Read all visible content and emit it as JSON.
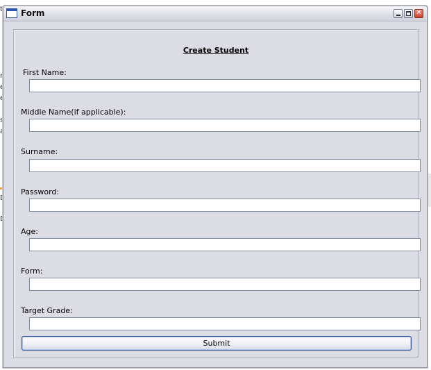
{
  "window": {
    "title": "Form",
    "minimize_icon": "minimize-icon",
    "maximize_icon": "maximize-icon",
    "close_icon": "close-icon",
    "close_color": "#d24a32"
  },
  "form": {
    "heading": "Create Student",
    "fields": [
      {
        "label": "First Name:",
        "value": ""
      },
      {
        "label": "Middle Name(if applicable):",
        "value": ""
      },
      {
        "label": "Surname:",
        "value": ""
      },
      {
        "label": "Password:",
        "value": ""
      },
      {
        "label": "Age:",
        "value": ""
      },
      {
        "label": "Form:",
        "value": ""
      },
      {
        "label": "Target Grade:",
        "value": ""
      }
    ],
    "submit_label": "Submit"
  },
  "background": {
    "left_fragments": [
      "t",
      "r",
      "e",
      "e",
      "s",
      "a",
      "D",
      "D"
    ]
  }
}
